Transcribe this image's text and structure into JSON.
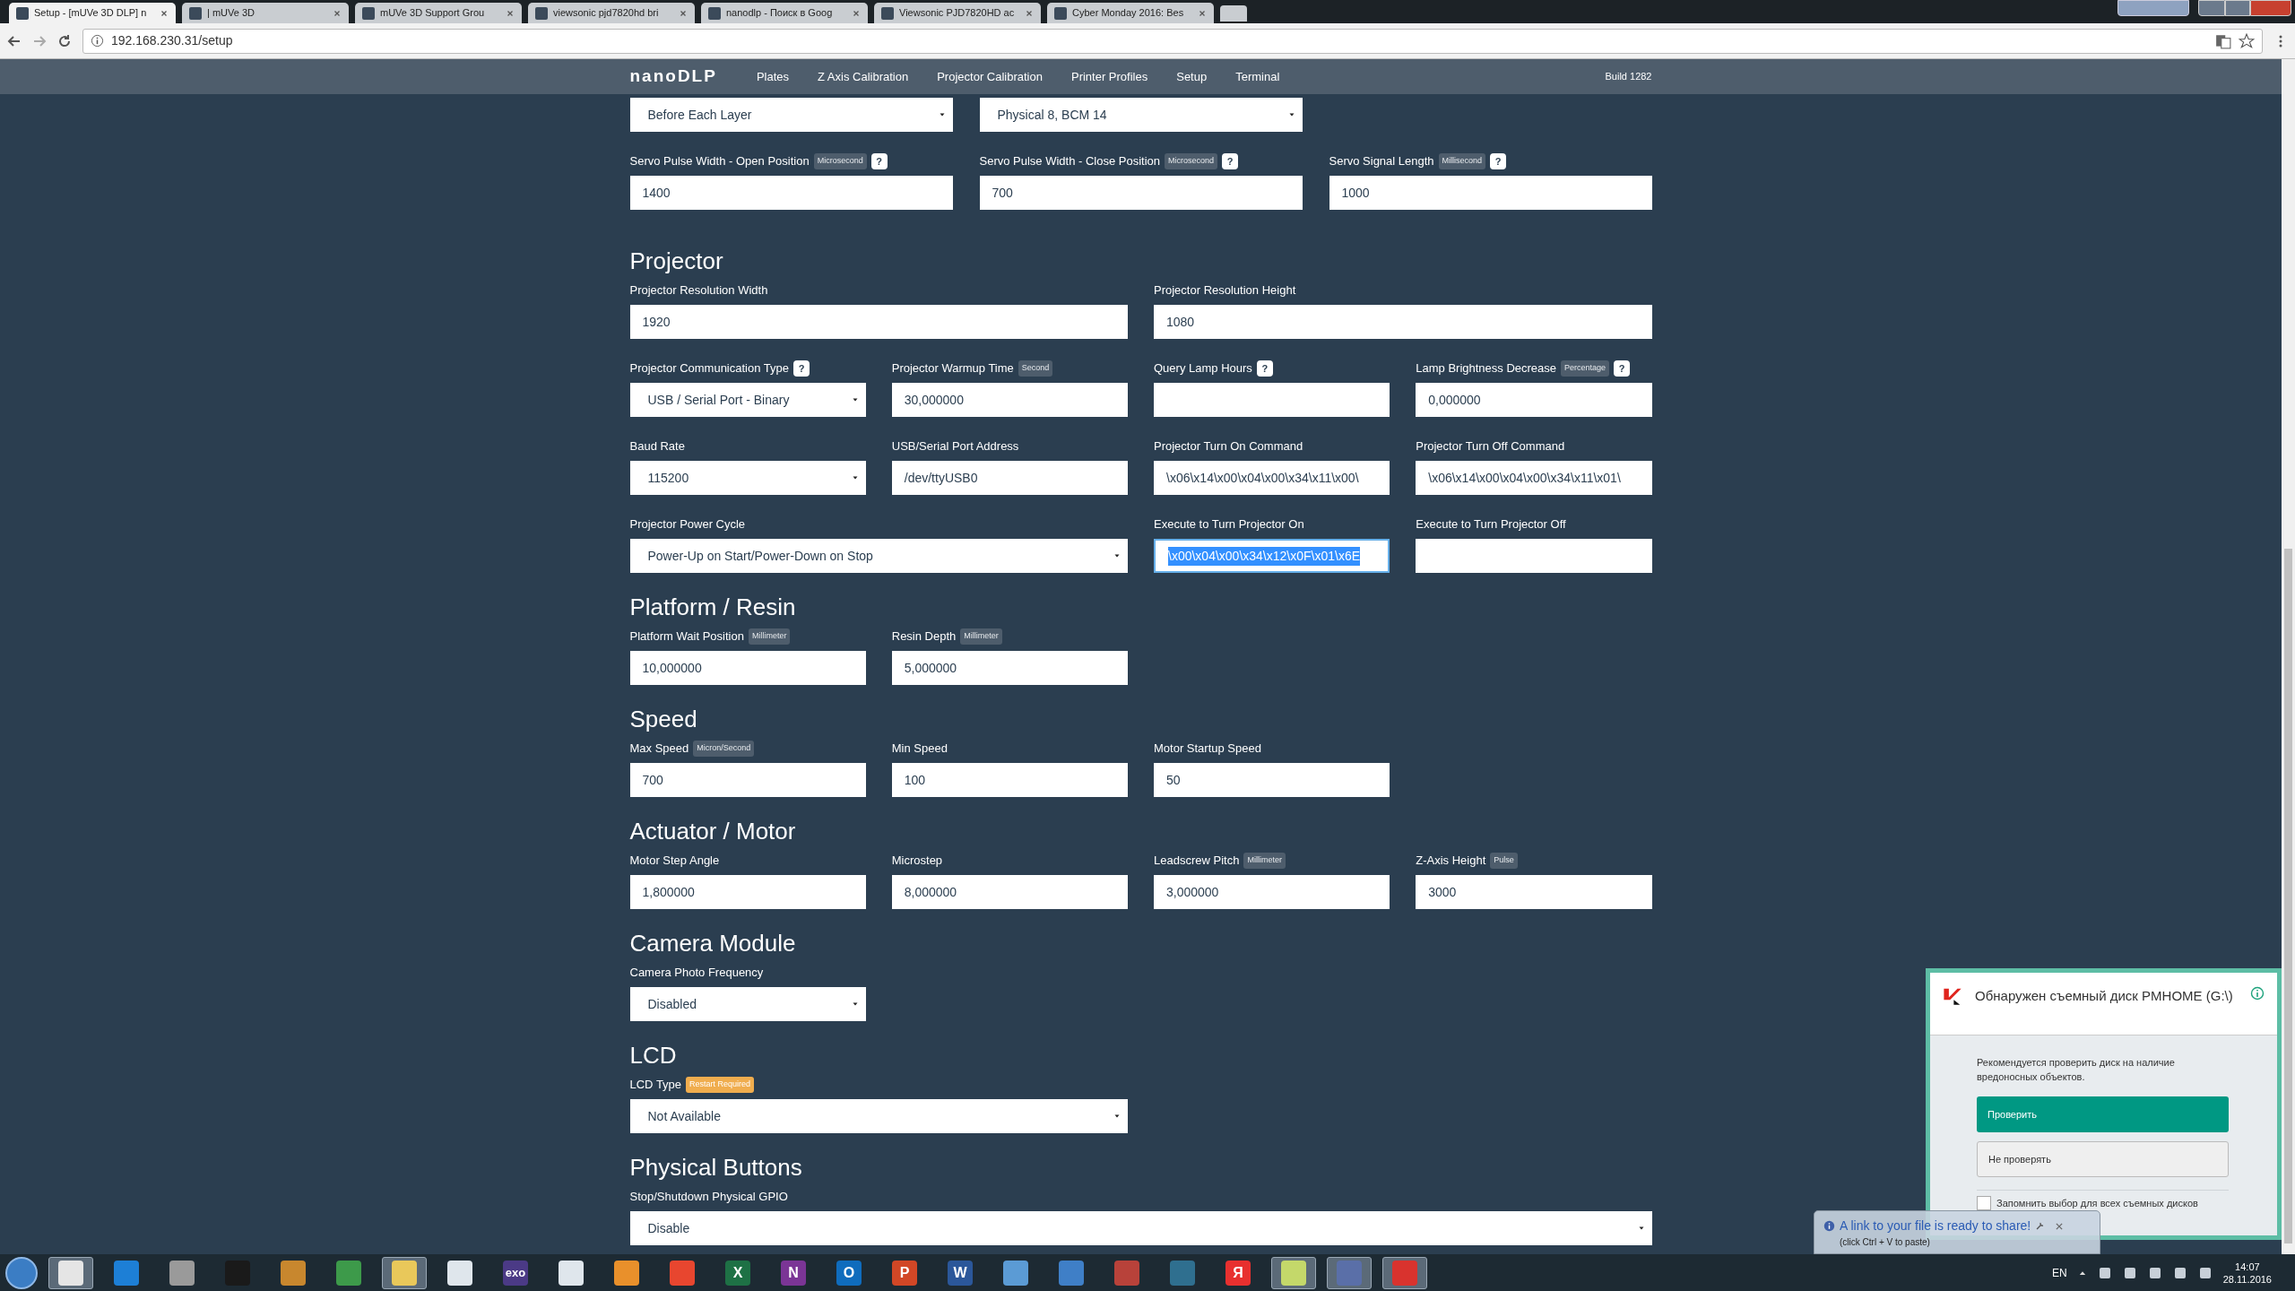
{
  "browser": {
    "tabs": [
      {
        "title": "Setup - [mUVe 3D DLP] n",
        "selected": true
      },
      {
        "title": "| mUVe 3D",
        "selected": false
      },
      {
        "title": "mUVe 3D Support Grou",
        "selected": false
      },
      {
        "title": "viewsonic pjd7820hd bri",
        "selected": false
      },
      {
        "title": "nanodlp - Поиск в Goog",
        "selected": false
      },
      {
        "title": "Viewsonic PJD7820HD ac",
        "selected": false
      },
      {
        "title": "Cyber Monday 2016: Bes",
        "selected": false
      }
    ],
    "url": "192.168.230.31/setup"
  },
  "navbar": {
    "brand": "nanoDLP",
    "items": [
      {
        "label": "Plates",
        "selected": false
      },
      {
        "label": "Z Axis Calibration",
        "selected": false
      },
      {
        "label": "Projector Calibration",
        "selected": false
      },
      {
        "label": "Printer Profiles",
        "selected": false
      },
      {
        "label": "Setup",
        "selected": false
      },
      {
        "label": "Terminal",
        "selected": false
      }
    ],
    "build": "Build 1282"
  },
  "sections": [
    {
      "rows": [
        [
          {
            "kind": "select",
            "value": "Before Each Layer",
            "focused": false
          },
          {
            "kind": "select",
            "value": "Physical 8, BCM 14",
            "focused": false
          }
        ],
        [
          {
            "kind": "input",
            "label": "Servo Pulse Width - Open Position",
            "badge": {
              "text": "Microsecond",
              "kind": "unit"
            },
            "help": "?",
            "value": "1400",
            "focused": false
          },
          {
            "kind": "input",
            "label": "Servo Pulse Width - Close Position",
            "badge": {
              "text": "Microsecond",
              "kind": "unit"
            },
            "help": "?",
            "value": "700",
            "focused": false
          },
          {
            "kind": "input",
            "label": "Servo Signal Length",
            "badge": {
              "text": "Millisecond",
              "kind": "unit"
            },
            "help": "?",
            "value": "1000",
            "focused": false
          }
        ]
      ]
    },
    {
      "heading": "Projector",
      "rows": [
        [
          {
            "kind": "input",
            "label": "Projector Resolution Width",
            "value": "1920",
            "focused": false
          },
          null,
          {
            "kind": "input",
            "label": "Projector Resolution Height",
            "value": "1080",
            "focused": false
          }
        ],
        [
          {
            "kind": "select",
            "label": "Projector Communication Type",
            "help": "?",
            "value": "USB / Serial Port - Binary",
            "focused": false
          },
          {
            "kind": "input",
            "label": "Projector Warmup Time",
            "badge": {
              "text": "Second",
              "kind": "unit"
            },
            "value": "30,000000",
            "focused": false
          },
          {
            "kind": "input",
            "label": "Query Lamp Hours",
            "help": "?",
            "focused": false
          },
          {
            "kind": "input",
            "label": "Lamp Brightness Decrease",
            "badge": {
              "text": "Percentage",
              "kind": "unit"
            },
            "help": "?",
            "value": "0,000000",
            "focused": false
          }
        ],
        [
          {
            "kind": "select",
            "label": "Baud Rate",
            "value": "115200",
            "focused": false
          },
          {
            "kind": "input",
            "label": "USB/Serial Port Address",
            "value": "/dev/ttyUSB0",
            "focused": false
          },
          {
            "kind": "input",
            "label": "Projector Turn On Command",
            "value": "\\x06\\x14\\x00\\x04\\x00\\x34\\x11\\x00\\",
            "focused": false
          },
          {
            "kind": "input",
            "label": "Projector Turn Off Command",
            "value": "\\x06\\x14\\x00\\x04\\x00\\x34\\x11\\x01\\",
            "focused": false
          }
        ],
        [
          {
            "kind": "select",
            "label": "Projector Power Cycle",
            "value": "Power-Up on Start/Power-Down on Stop",
            "focused": false
          },
          null,
          {
            "kind": "input",
            "label": "Execute to Turn Projector On",
            "value": "\\x00\\x04\\x00\\x34\\x12\\x0F\\x01\\x6E",
            "focused": true
          },
          {
            "kind": "input",
            "label": "Execute to Turn Projector Off",
            "focused": false
          }
        ]
      ]
    },
    {
      "heading": "Platform / Resin",
      "rows": [
        [
          {
            "kind": "input",
            "label": "Platform Wait Position",
            "badge": {
              "text": "Millimeter",
              "kind": "unit"
            },
            "value": "10,000000",
            "focused": false
          },
          {
            "kind": "input",
            "label": "Resin Depth",
            "badge": {
              "text": "Millimeter",
              "kind": "unit"
            },
            "value": "5,000000",
            "focused": false
          }
        ]
      ]
    },
    {
      "heading": "Speed",
      "rows": [
        [
          {
            "kind": "input",
            "label": "Max Speed",
            "badge": {
              "text": "Micron/Second",
              "kind": "unit"
            },
            "value": "700",
            "focused": false
          },
          {
            "kind": "input",
            "label": "Min Speed",
            "value": "100",
            "focused": false
          },
          {
            "kind": "input",
            "label": "Motor Startup Speed",
            "value": "50",
            "focused": false
          }
        ]
      ]
    },
    {
      "heading": "Actuator / Motor",
      "rows": [
        [
          {
            "kind": "input",
            "label": "Motor Step Angle",
            "value": "1,800000",
            "focused": false
          },
          {
            "kind": "input",
            "label": "Microstep",
            "value": "8,000000",
            "focused": false
          },
          {
            "kind": "input",
            "label": "Leadscrew Pitch",
            "badge": {
              "text": "Millimeter",
              "kind": "unit"
            },
            "value": "3,000000",
            "focused": false
          },
          {
            "kind": "input",
            "label": "Z-Axis Height",
            "badge": {
              "text": "Pulse",
              "kind": "unit"
            },
            "value": "3000",
            "focused": false
          }
        ]
      ]
    },
    {
      "heading": "Camera Module",
      "rows": [
        [
          {
            "kind": "select",
            "label": "Camera Photo Frequency",
            "value": "Disabled",
            "focused": false
          }
        ]
      ]
    },
    {
      "heading": "LCD",
      "rows": [
        [
          {
            "kind": "select",
            "label": "LCD Type",
            "badge": {
              "text": "Restart Required",
              "kind": "warning"
            },
            "value": "Not Available",
            "focused": false
          }
        ]
      ]
    },
    {
      "heading": "Physical Buttons",
      "rows": [
        [
          {
            "kind": "select",
            "label": "Stop/Shutdown Physical GPIO",
            "value": "Disable",
            "focused": false
          }
        ]
      ]
    }
  ],
  "popup": {
    "title": "Обнаружен съемный диск PMHOME (G:\\)",
    "message": "Рекомендуется проверить диск на наличие вредоносных объектов.",
    "primary_button": "Проверить",
    "secondary_button": "Не проверять",
    "remember": {
      "label": "Запомнить выбор для всех съемных дисков",
      "checked": false
    }
  },
  "toast": {
    "title": "A link to your file is ready to share!",
    "hint": "(click Ctrl + V to paste)"
  },
  "taskbar": {
    "apps": [
      {
        "color": "#e5e5e5",
        "running": true
      },
      {
        "color": "#1d7fd6",
        "running": false
      },
      {
        "color": "#9a9a9a",
        "running": false
      },
      {
        "color": "#1a1a1a",
        "running": false
      },
      {
        "color": "#c8872e",
        "running": false
      },
      {
        "color": "#3d9a4a",
        "running": false
      },
      {
        "color": "#e9c85a",
        "running": true
      },
      {
        "color": "#dfe6ec",
        "running": false
      },
      {
        "color": "#4b3a86",
        "glyph": "exo",
        "running": false
      },
      {
        "color": "#dfe6ec",
        "running": false
      },
      {
        "color": "#e9902b",
        "running": false
      },
      {
        "color": "#e8462f",
        "running": false
      },
      {
        "color": "#1e7145",
        "glyph": "X",
        "running": false
      },
      {
        "color": "#7b3596",
        "glyph": "N",
        "running": false
      },
      {
        "color": "#0f6cbd",
        "glyph": "O",
        "running": false
      },
      {
        "color": "#d24726",
        "glyph": "P",
        "running": false
      },
      {
        "color": "#2b579a",
        "glyph": "W",
        "running": false
      },
      {
        "color": "#5b9bd5",
        "running": false
      },
      {
        "color": "#3f7fc7",
        "running": false
      },
      {
        "color": "#b8423a",
        "running": false
      },
      {
        "color": "#2f6f8f",
        "running": false
      },
      {
        "color": "#e8302f",
        "glyph": "Я",
        "running": false
      },
      {
        "color": "#c4d86a",
        "running": true
      },
      {
        "color": "#5a6fa8",
        "running": true
      },
      {
        "color": "#d9332e",
        "running": true
      }
    ],
    "language": "EN",
    "time": "14:07",
    "date": "28.11.2016"
  }
}
